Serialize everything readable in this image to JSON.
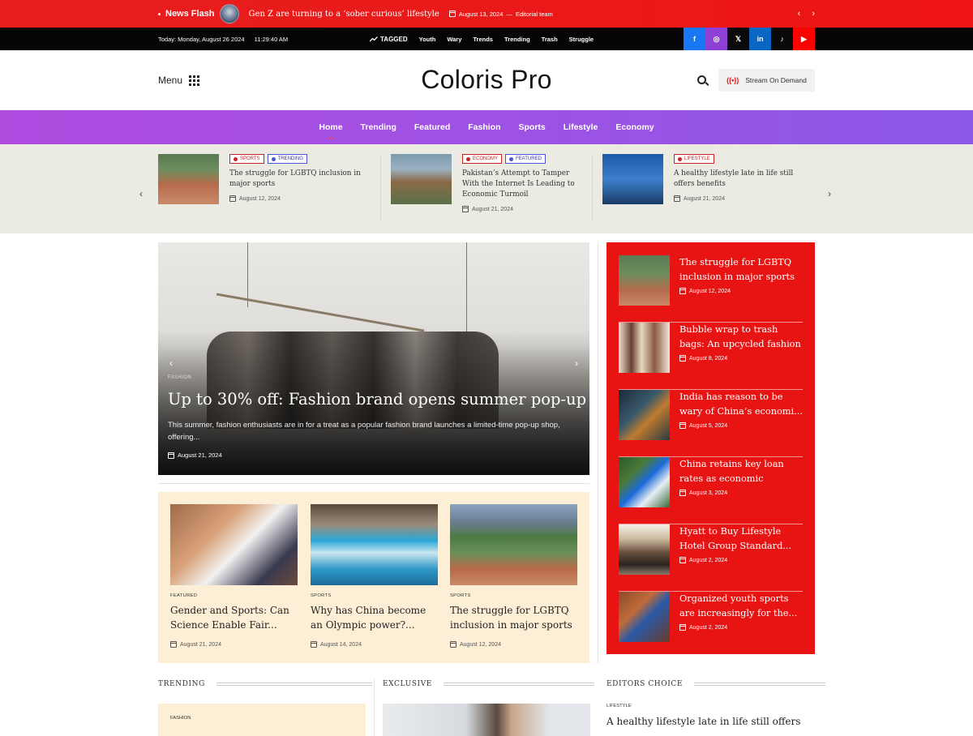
{
  "newsflash": {
    "label": "News Flash",
    "title": "Gen Z are turning to a ‘sober curious’ lifestyle",
    "date": "August 13, 2024",
    "dash": "—",
    "author": "Editorial team",
    "prev": "‹",
    "next": "›"
  },
  "topbar": {
    "date": "Today: Monday, August 26 2024",
    "time": "11:29:40 AM",
    "tagged_label": "TAGGED",
    "tags": [
      "Youth",
      "Wary",
      "Trends",
      "Trending",
      "Trash",
      "Struggle"
    ],
    "social": [
      {
        "name": "facebook",
        "glyph": "f",
        "color": "#1877f2"
      },
      {
        "name": "instagram",
        "glyph": "◎",
        "color": "#8e3fd6"
      },
      {
        "name": "x",
        "glyph": "𝕏",
        "color": "#0a0a0a"
      },
      {
        "name": "linkedin",
        "glyph": "in",
        "color": "#0a66c2"
      },
      {
        "name": "tiktok",
        "glyph": "♪",
        "color": "#0a0a0a"
      },
      {
        "name": "youtube",
        "glyph": "▶",
        "color": "#ff0000"
      }
    ]
  },
  "header": {
    "menu_label": "Menu",
    "logo": "Coloris Pro",
    "stream_label": "Stream On Demand",
    "stream_icon": "((•))"
  },
  "nav": [
    "Home",
    "Trending",
    "Featured",
    "Fashion",
    "Sports",
    "Lifestyle",
    "Economy"
  ],
  "strip": {
    "prev": "‹",
    "next": "›",
    "items": [
      {
        "badges": [
          "SPORTS",
          "TRENDING"
        ],
        "title": "The struggle for LGBTQ inclusion in major sports",
        "date": "August 12, 2024"
      },
      {
        "badges": [
          "ECONOMY",
          "FEATURED"
        ],
        "title": "Pakistan’s Attempt to Tamper With the Internet Is Leading to Economic Turmoil",
        "date": "August 21, 2024"
      },
      {
        "badges": [
          "LIFESTYLE"
        ],
        "title": "A healthy lifestyle late in life still offers benefits",
        "date": "August 21, 2024"
      }
    ]
  },
  "hero": {
    "category": "FASHION",
    "title": "Up to 30% off: Fashion brand opens summer pop-up",
    "excerpt": "This summer, fashion enthusiasts are in for a treat as a popular fashion brand launches a limited-time pop-up shop, offering...",
    "date": "August 21, 2024",
    "prev": "‹",
    "next": "›"
  },
  "cards": [
    {
      "category": "FEATURED",
      "title": "Gender and Sports: Can Science Enable Fair...",
      "date": "August 21, 2024"
    },
    {
      "category": "SPORTS",
      "title": "Why has China become an Olympic power?...",
      "date": "August 14, 2024"
    },
    {
      "category": "SPORTS",
      "title": "The struggle for LGBTQ inclusion in major sports",
      "date": "August 12, 2024"
    }
  ],
  "sidebar": [
    {
      "title": "The struggle for LGBTQ inclusion in major sports",
      "date": "August 12, 2024"
    },
    {
      "title": "Bubble wrap to trash bags: An upcycled fashion sho...",
      "date": "August 8, 2024"
    },
    {
      "title": "India has reason to be wary of China’s economi...",
      "date": "August 5, 2024"
    },
    {
      "title": "China retains key loan rates as economic recove...",
      "date": "August 3, 2024"
    },
    {
      "title": "Hyatt to Buy Lifestyle Hotel Group Standard...",
      "date": "August 2, 2024"
    },
    {
      "title": "Organized youth sports are increasingly for the...",
      "date": "August 2, 2024"
    }
  ],
  "sections": {
    "trending": "TRENDING",
    "exclusive": "EXCLUSIVE",
    "editors": "EDITORS CHOICE",
    "trend_cat": "FASHION",
    "editors_cat": "LIFESTYLE",
    "editors_title": "A healthy lifestyle late in life still offers"
  }
}
